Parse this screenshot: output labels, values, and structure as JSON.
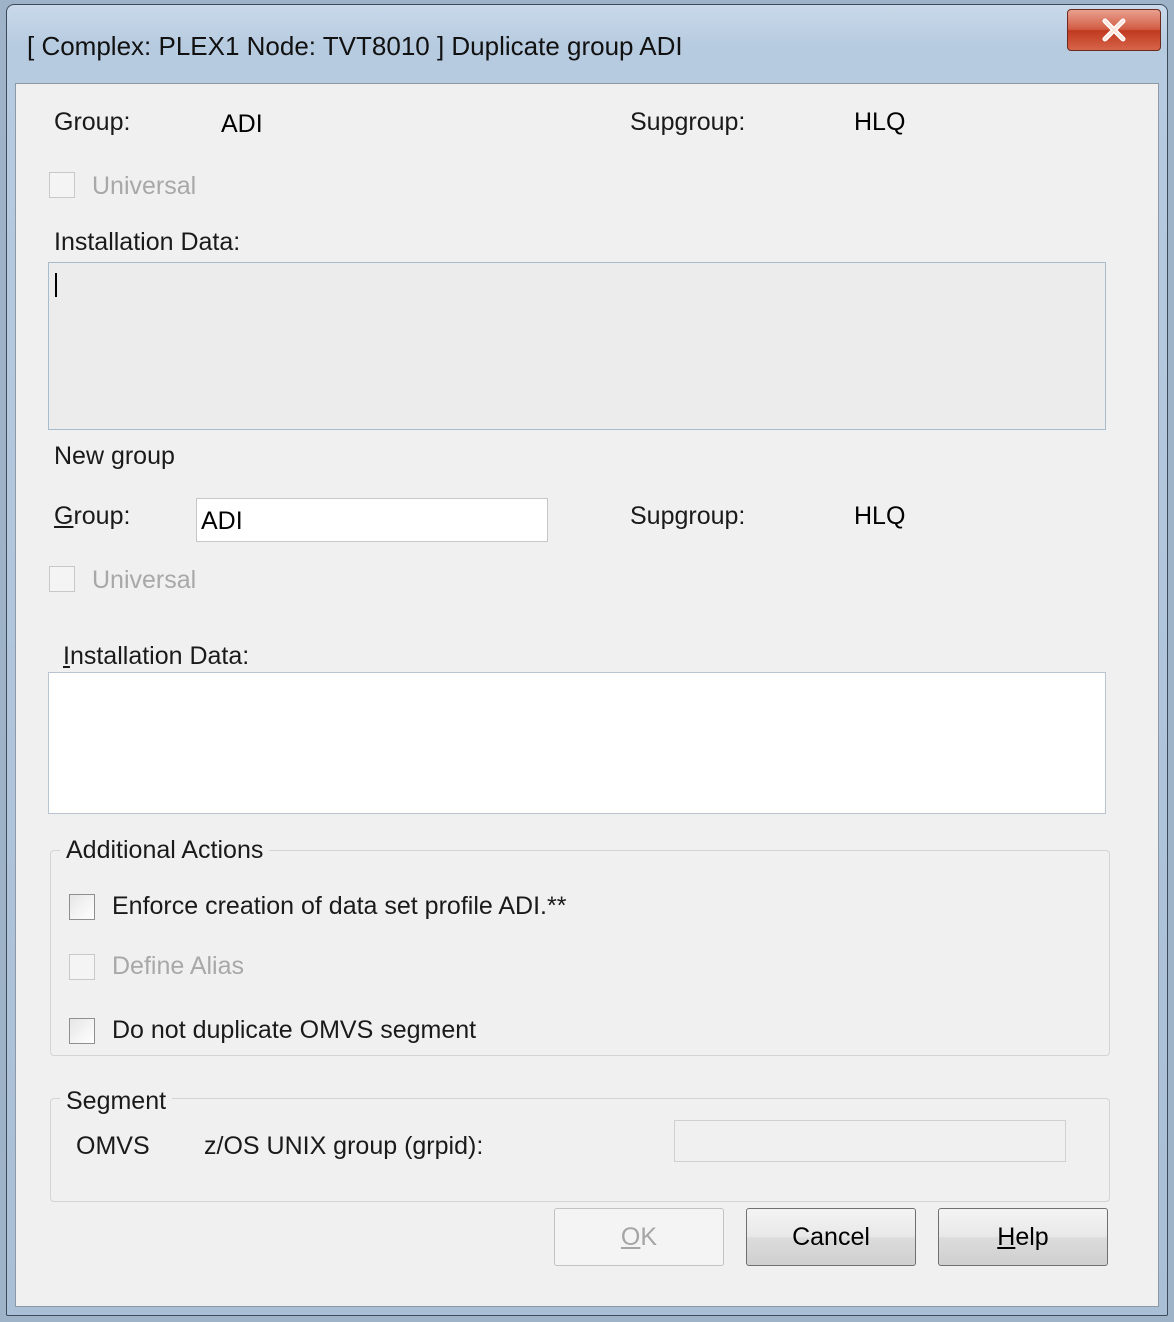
{
  "window": {
    "title": "[ Complex: PLEX1 Node: TVT8010 ] Duplicate group ADI"
  },
  "source": {
    "group_label": "Group:",
    "group_value": "ADI",
    "supgroup_label": "Supgroup:",
    "supgroup_value": "HLQ",
    "universal_label": "Universal",
    "universal_checked": false,
    "installation_data_label": "Installation Data:",
    "installation_data_value": ""
  },
  "new_group": {
    "heading": "New group",
    "group_label_mnemonic": "G",
    "group_label_rest": "roup:",
    "group_value": "ADI",
    "supgroup_label": "Supgroup:",
    "supgroup_value": "HLQ",
    "universal_label": "Universal",
    "universal_checked": false,
    "installation_data_label_mnemonic": "I",
    "installation_data_label_rest": "nstallation Data:",
    "installation_data_value": ""
  },
  "additional_actions": {
    "title": "Additional Actions",
    "items": [
      {
        "label": "Enforce creation of data set profile ADI.**",
        "checked": false,
        "enabled": true
      },
      {
        "label": "Define Alias",
        "checked": false,
        "enabled": false
      },
      {
        "label": "Do not duplicate OMVS segment",
        "checked": false,
        "enabled": true
      }
    ]
  },
  "segment": {
    "title": "Segment",
    "name": "OMVS",
    "field_label": "z/OS UNIX group (grpid):",
    "field_value": ""
  },
  "buttons": {
    "ok_mnemonic": "O",
    "ok_rest": "K",
    "cancel": "Cancel",
    "help_mnemonic": "H",
    "help_rest": "elp"
  },
  "icons": {
    "close": "close-x-icon"
  }
}
